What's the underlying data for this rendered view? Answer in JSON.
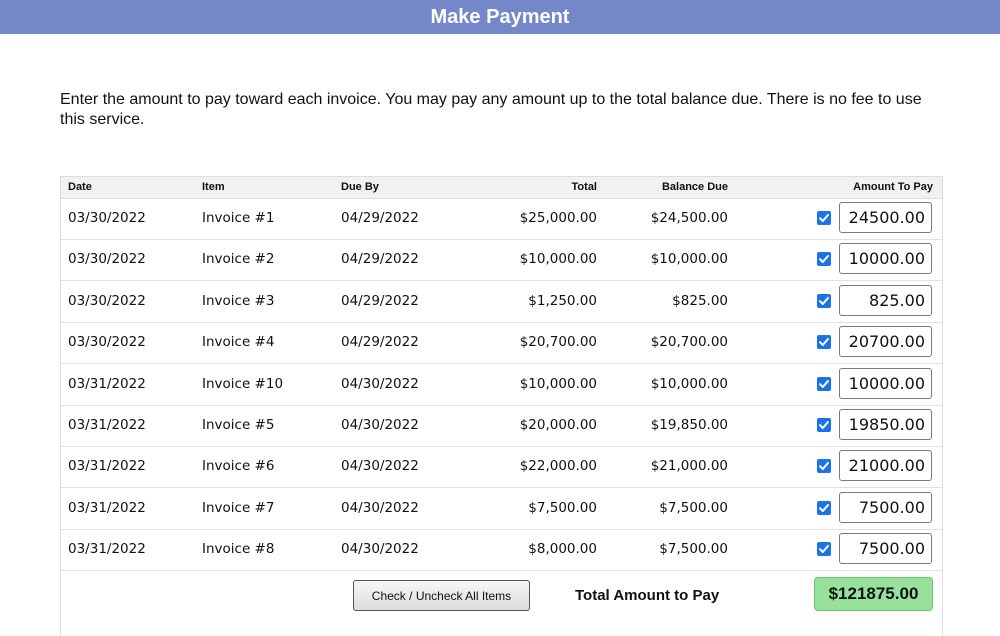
{
  "page": {
    "title": "Make Payment",
    "intro": "Enter the amount to pay toward each invoice. You may pay any amount up to the total balance due. There is no fee to use this service."
  },
  "table": {
    "headers": {
      "date": "Date",
      "item": "Item",
      "due_by": "Due By",
      "total": "Total",
      "balance_due": "Balance Due",
      "amount_to_pay": "Amount To Pay"
    },
    "rows": [
      {
        "date": "03/30/2022",
        "item": "Invoice #1",
        "due_by": "04/29/2022",
        "total": "$25,000.00",
        "balance_due": "$24,500.00",
        "checked": true,
        "amount": "24500.00"
      },
      {
        "date": "03/30/2022",
        "item": "Invoice #2",
        "due_by": "04/29/2022",
        "total": "$10,000.00",
        "balance_due": "$10,000.00",
        "checked": true,
        "amount": "10000.00"
      },
      {
        "date": "03/30/2022",
        "item": "Invoice #3",
        "due_by": "04/29/2022",
        "total": "$1,250.00",
        "balance_due": "$825.00",
        "checked": true,
        "amount": "825.00"
      },
      {
        "date": "03/30/2022",
        "item": "Invoice #4",
        "due_by": "04/29/2022",
        "total": "$20,700.00",
        "balance_due": "$20,700.00",
        "checked": true,
        "amount": "20700.00"
      },
      {
        "date": "03/31/2022",
        "item": "Invoice #10",
        "due_by": "04/30/2022",
        "total": "$10,000.00",
        "balance_due": "$10,000.00",
        "checked": true,
        "amount": "10000.00"
      },
      {
        "date": "03/31/2022",
        "item": "Invoice #5",
        "due_by": "04/30/2022",
        "total": "$20,000.00",
        "balance_due": "$19,850.00",
        "checked": true,
        "amount": "19850.00"
      },
      {
        "date": "03/31/2022",
        "item": "Invoice #6",
        "due_by": "04/30/2022",
        "total": "$22,000.00",
        "balance_due": "$21,000.00",
        "checked": true,
        "amount": "21000.00"
      },
      {
        "date": "03/31/2022",
        "item": "Invoice #7",
        "due_by": "04/30/2022",
        "total": "$7,500.00",
        "balance_due": "$7,500.00",
        "checked": true,
        "amount": "7500.00"
      },
      {
        "date": "03/31/2022",
        "item": "Invoice #8",
        "due_by": "04/30/2022",
        "total": "$8,000.00",
        "balance_due": "$7,500.00",
        "checked": true,
        "amount": "7500.00"
      }
    ]
  },
  "footer": {
    "toggle_button": "Check / Uncheck All Items",
    "total_label": "Total Amount to Pay",
    "total_value": "$121875.00"
  },
  "colors": {
    "header_bg": "#7487c9",
    "checkbox": "#1a73e8",
    "total_bg": "#98e19a"
  },
  "icons": {
    "checkbox": "check-icon"
  }
}
